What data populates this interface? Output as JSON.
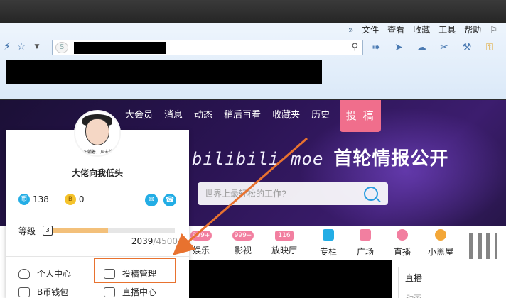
{
  "browser": {
    "menu": [
      "文件",
      "查看",
      "收藏",
      "工具",
      "帮助"
    ],
    "chevron": "»"
  },
  "site": {
    "nav": [
      "大会员",
      "消息",
      "动态",
      "稍后再看",
      "收藏夹",
      "历史"
    ],
    "submit_label": "投 稿",
    "banner_logo": "bilibili moe",
    "banner_title": "首轮情报公开",
    "search_placeholder": "世界上最轻松的工作?",
    "categories": [
      {
        "badge": "999+",
        "label": "娱乐"
      },
      {
        "badge": "999+",
        "label": "影视"
      },
      {
        "badge": "116",
        "label": "放映厅"
      },
      {
        "badge": "",
        "label": "专栏",
        "color": "#23ade5"
      },
      {
        "badge": "",
        "label": "广场",
        "color": "#f27fa0"
      },
      {
        "badge": "",
        "label": "直播",
        "color": "#f27fa0"
      },
      {
        "badge": "",
        "label": "小黑屋",
        "color": "#f3a738"
      }
    ],
    "live_tab": "直播",
    "live_tab_sub": "动画"
  },
  "panel": {
    "avatar_caption": "\"在躺着，从未停\"",
    "username": "大佬向我低头",
    "coins": {
      "coin_icon": "币",
      "coin_value": "138",
      "b_icon": "B",
      "b_value": "0"
    },
    "level_label": "等级",
    "level_badge": "3",
    "exp_current": "2039",
    "exp_max": "/4500",
    "exp_fraction": 0.453,
    "links": [
      {
        "label": "个人中心"
      },
      {
        "label": "投稿管理"
      },
      {
        "label": "B币钱包"
      },
      {
        "label": "直播中心"
      }
    ]
  },
  "colors": {
    "accent_pink": "#f06e8c",
    "highlight_orange": "#e8722f",
    "bili_blue": "#23ade5"
  }
}
